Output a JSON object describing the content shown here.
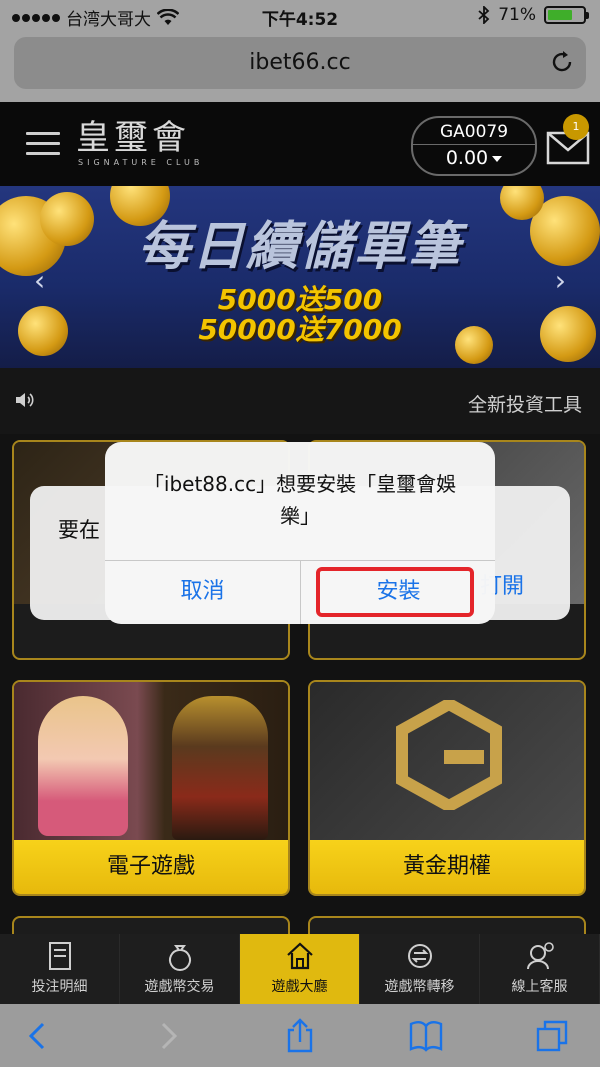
{
  "status_bar": {
    "carrier": "台湾大哥大",
    "time": "下午4:52",
    "battery": "71%",
    "battery_level": 0.71
  },
  "browser": {
    "url": "ibet66.cc"
  },
  "header": {
    "logo_main": "皇璽會",
    "logo_sub": "SIGNATURE CLUB",
    "account_id": "GA0079",
    "balance": "0.00",
    "mail_count": "1"
  },
  "banner": {
    "title": "每日續儲單筆",
    "line1": "5000送500",
    "line2": "50000送7000"
  },
  "notice": {
    "text": "全新投資工具"
  },
  "tiles": [
    {
      "label": "電子遊戲"
    },
    {
      "label": "黃金期權"
    }
  ],
  "back_dialog": {
    "message": "要在",
    "open_label": "打開"
  },
  "alert": {
    "message": "「ibet88.cc」想要安裝「皇璽會娛樂」",
    "cancel": "取消",
    "install": "安裝"
  },
  "bottom_nav": [
    {
      "label": "投注明細"
    },
    {
      "label": "遊戲幣交易"
    },
    {
      "label": "遊戲大廳",
      "active": true
    },
    {
      "label": "遊戲幣轉移"
    },
    {
      "label": "線上客服"
    }
  ],
  "colors": {
    "accent_gold": "#e0b90f",
    "ios_blue": "#1a73e8",
    "highlight_red": "#e4252a"
  }
}
